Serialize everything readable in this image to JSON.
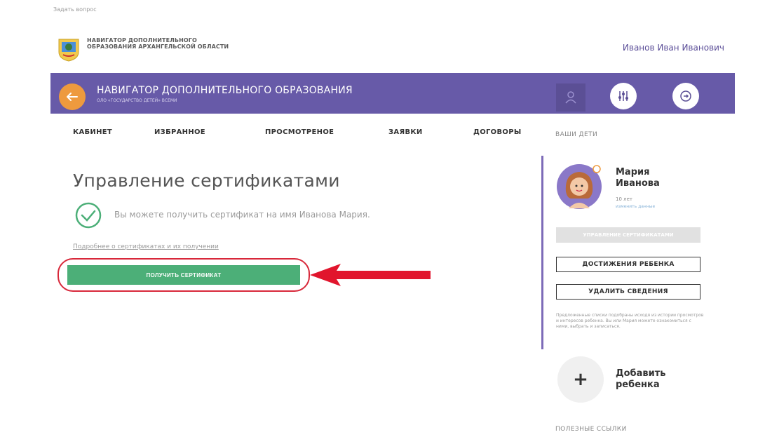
{
  "top": {
    "ask_question": "Задать вопрос",
    "logo_text": "НАВИГАТОР ДОПОЛНИТЕЛЬНОГО ОБРАЗОВАНИЯ АРХАНГЕЛЬСКОЙ ОБЛАСТИ",
    "user_name": "Иванов Иван Иванович"
  },
  "navbar": {
    "title": "НАВИГАТОР ДОПОЛНИТЕЛЬНОГО ОБРАЗОВАНИЯ",
    "subtitle": "ОЛО «ГОСУДАРСТВО ДЕТЕЙ» ВСЕМИ"
  },
  "tabs": [
    {
      "label": "КАБИНЕТ"
    },
    {
      "label": "ИЗБРАННОЕ"
    },
    {
      "label": "ПРОСМОТРЕНОЕ"
    },
    {
      "label": "ЗАЯВКИ"
    },
    {
      "label": "ДОГОВОРЫ"
    }
  ],
  "main": {
    "title": "Управление сертификатами",
    "info": "Вы можете получить сертификат на имя Иванова Мария.",
    "more_link": "Подробнее о сертификатах и их получении",
    "get_certificate": "ПОЛУЧИТЬ СЕРТИФИКАТ"
  },
  "sidebar": {
    "section_title": "ВАШИ ДЕТИ",
    "child": {
      "name": "Мария Иванова",
      "age": "10 лет",
      "edit": "изменить данные"
    },
    "manage_certificates": "УПРАВЛЕНИЕ СЕРТИФИКАТАМИ",
    "achievements": "ДОСТИЖЕНИЯ РЕБЕНКА",
    "delete_info": "УДАЛИТЬ СВЕДЕНИЯ",
    "note": "Предложенные списки подобраны исходя из истории просмотров и интересов ребенка. Вы или Мария можете ознакомиться с ними, выбрать и записаться.",
    "add_child": "Добавить ребенка",
    "useful_links": "ПОЛЕЗНЫЕ ССЫЛКИ"
  },
  "colors": {
    "nav_purple": "#675aa8",
    "back_orange": "#ee9a3e",
    "button_green": "#4caf78",
    "highlight_red": "#d8283a"
  }
}
